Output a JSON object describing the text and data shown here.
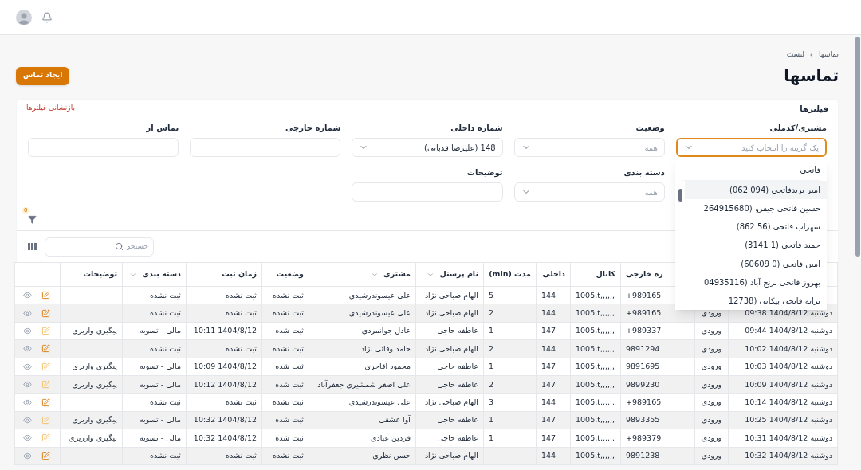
{
  "breadcrumb": [
    "تماسها",
    "لیست"
  ],
  "title": "تماسها",
  "create_button": "ایجاد تماس",
  "filters": {
    "title": "فیلترها",
    "reset": "بازنشانی فیلترها",
    "active_count": "0",
    "fields": [
      {
        "label": "مشتری/کدملی",
        "kind": "select",
        "placeholder": "یک گزینه را انتخاب کنید",
        "focused": true
      },
      {
        "label": "وضعیت",
        "kind": "select",
        "placeholder": "همه",
        "focused": false
      },
      {
        "label": "شماره داخلی",
        "kind": "select",
        "value": "148 (علیرضا قدبانی)",
        "focused": false
      },
      {
        "label": "شماره خارجی",
        "kind": "input",
        "focused": false
      },
      {
        "label": "تماس از",
        "kind": "input",
        "focused": false
      },
      {
        "label": "دسته بندی",
        "kind": "select",
        "placeholder": "همه",
        "focused": false
      },
      {
        "label": "توضیحات",
        "kind": "input",
        "focused": false
      }
    ]
  },
  "dropdown": {
    "search_value": "فاتحی",
    "options": [
      {
        "label": "امیر بریدفاتحی (094 062)",
        "selected": true
      },
      {
        "label": "حسین فاتحی جیفرو (264915680",
        "selected": false
      },
      {
        "label": "سهراب فاتحی (56 862)",
        "selected": false
      },
      {
        "label": "حمید فاتحی (1 3141)",
        "selected": false
      },
      {
        "label": "امین فاتحی (0 60609)",
        "selected": false
      },
      {
        "label": "بهروز فاتحی برنج آباد (04935116",
        "selected": false
      },
      {
        "label": "ترانه فاتحی بیکانی (12738",
        "selected": false
      }
    ]
  },
  "search": {
    "placeholder": "جستجو"
  },
  "table": {
    "columns": [
      {},
      {},
      {
        "label": "ره خارجی",
        "sortable": false
      },
      {
        "label": "کانال",
        "sortable": false
      },
      {
        "label": "داخلی",
        "sortable": false
      },
      {
        "label": "مدت (min)",
        "sortable": false
      },
      {
        "label": "نام پرسنل",
        "sortable": true
      },
      {
        "label": "مشتری",
        "sortable": true
      },
      {
        "label": "وضعیت",
        "sortable": false
      },
      {
        "label": "زمان ثبت",
        "sortable": false
      },
      {
        "label": "دسته بندی",
        "sortable": true
      },
      {
        "label": "توضیحات",
        "sortable": false
      }
    ],
    "rows": [
      {
        "cells": [
          null,
          null,
          "+989165",
          "1005,t,,,,,,",
          "144",
          "5",
          "الهام صباحی نژاد",
          "علی عیسوندرشیدی",
          "ثبت نشده",
          "ثبت نشده",
          "ثبت نشده",
          null
        ],
        "edit_emphasized": true
      },
      {
        "cells": [
          "دوشنبه 1404/8/12 09:38",
          "ورودی",
          "+989165",
          "1005,t,,,,,,",
          "144",
          "2",
          "الهام صباحی نژاد",
          "علی عیسوندرشیدی",
          "ثبت نشده",
          "ثبت نشده",
          "ثبت نشده",
          null
        ],
        "edit_emphasized": true
      },
      {
        "cells": [
          "دوشنبه 1404/8/12 09:44",
          "ورودی",
          "+989337",
          "1005,t,,,,,,",
          "147",
          "1",
          "عاطفه حاجی",
          "عادل جوانمردی",
          "ثبت شده",
          "1404/8/12 10:11",
          "مالی - تسویه",
          "پیگیری واریزی"
        ],
        "edit_emphasized": false
      },
      {
        "cells": [
          "دوشنبه 1404/8/12 10:02",
          "ورودی",
          "9891294",
          "1005,t,,,,,,",
          "144",
          "2",
          "الهام صباحی نژاد",
          "حامد وفائی نژاد",
          "ثبت نشده",
          "ثبت نشده",
          "ثبت نشده",
          null
        ],
        "edit_emphasized": true
      },
      {
        "cells": [
          "دوشنبه 1404/8/12 10:03",
          "ورودی",
          "9891695",
          "1005,t,,,,,,",
          "147",
          "1",
          "عاطفه حاجی",
          "محمود آقاجری",
          "ثبت شده",
          "1404/8/12 10:09",
          "مالی - تسویه",
          "پیگیری واریزی"
        ],
        "edit_emphasized": false
      },
      {
        "cells": [
          "دوشنبه 1404/8/12 10:09",
          "ورودی",
          "9899230",
          "1005,t,,,,,,",
          "147",
          "2",
          "عاطفه حاجی",
          "علی اصغر شمشیری جعفرآباد",
          "ثبت شده",
          "1404/8/12 10:12",
          "مالی - تسویه",
          "پیگیری واریزی"
        ],
        "edit_emphasized": false
      },
      {
        "cells": [
          "دوشنبه 1404/8/12 10:14",
          "ورودی",
          "+989165",
          "1005,t,,,,,,",
          "144",
          "3",
          "الهام صباحی نژاد",
          "علی عیسوندرشیدی",
          "ثبت نشده",
          "ثبت نشده",
          "ثبت نشده",
          null
        ],
        "edit_emphasized": true
      },
      {
        "cells": [
          "دوشنبه 1404/8/12 10:25",
          "ورودی",
          "9893355",
          "1005,t,,,,,,",
          "147",
          "1",
          "عاطفه حاجی",
          "آوا عشقی",
          "ثبت شده",
          "1404/8/12 10:32",
          "مالی - تسویه",
          "پیگیری واریزی"
        ],
        "edit_emphasized": false
      },
      {
        "cells": [
          "دوشنبه 1404/8/12 10:31",
          "ورودی",
          "+989379",
          "1005,t,,,,,,",
          "147",
          "1",
          "عاطفه حاجی",
          "فردین عبادی",
          "ثبت شده",
          "1404/8/12 10:32",
          "مالی - تسویه",
          "پیگیری وارزیزی"
        ],
        "edit_emphasized": false
      },
      {
        "cells": [
          "دوشنبه 1404/8/12 10:32",
          "ورودی",
          "9891238",
          "1005,t,,,,,,",
          "144",
          "-",
          "الهام صباحی نژاد",
          "حسن نظری",
          "ثبت نشده",
          "ثبت نشده",
          "ثبت نشده",
          null
        ],
        "edit_emphasized": true
      }
    ]
  }
}
